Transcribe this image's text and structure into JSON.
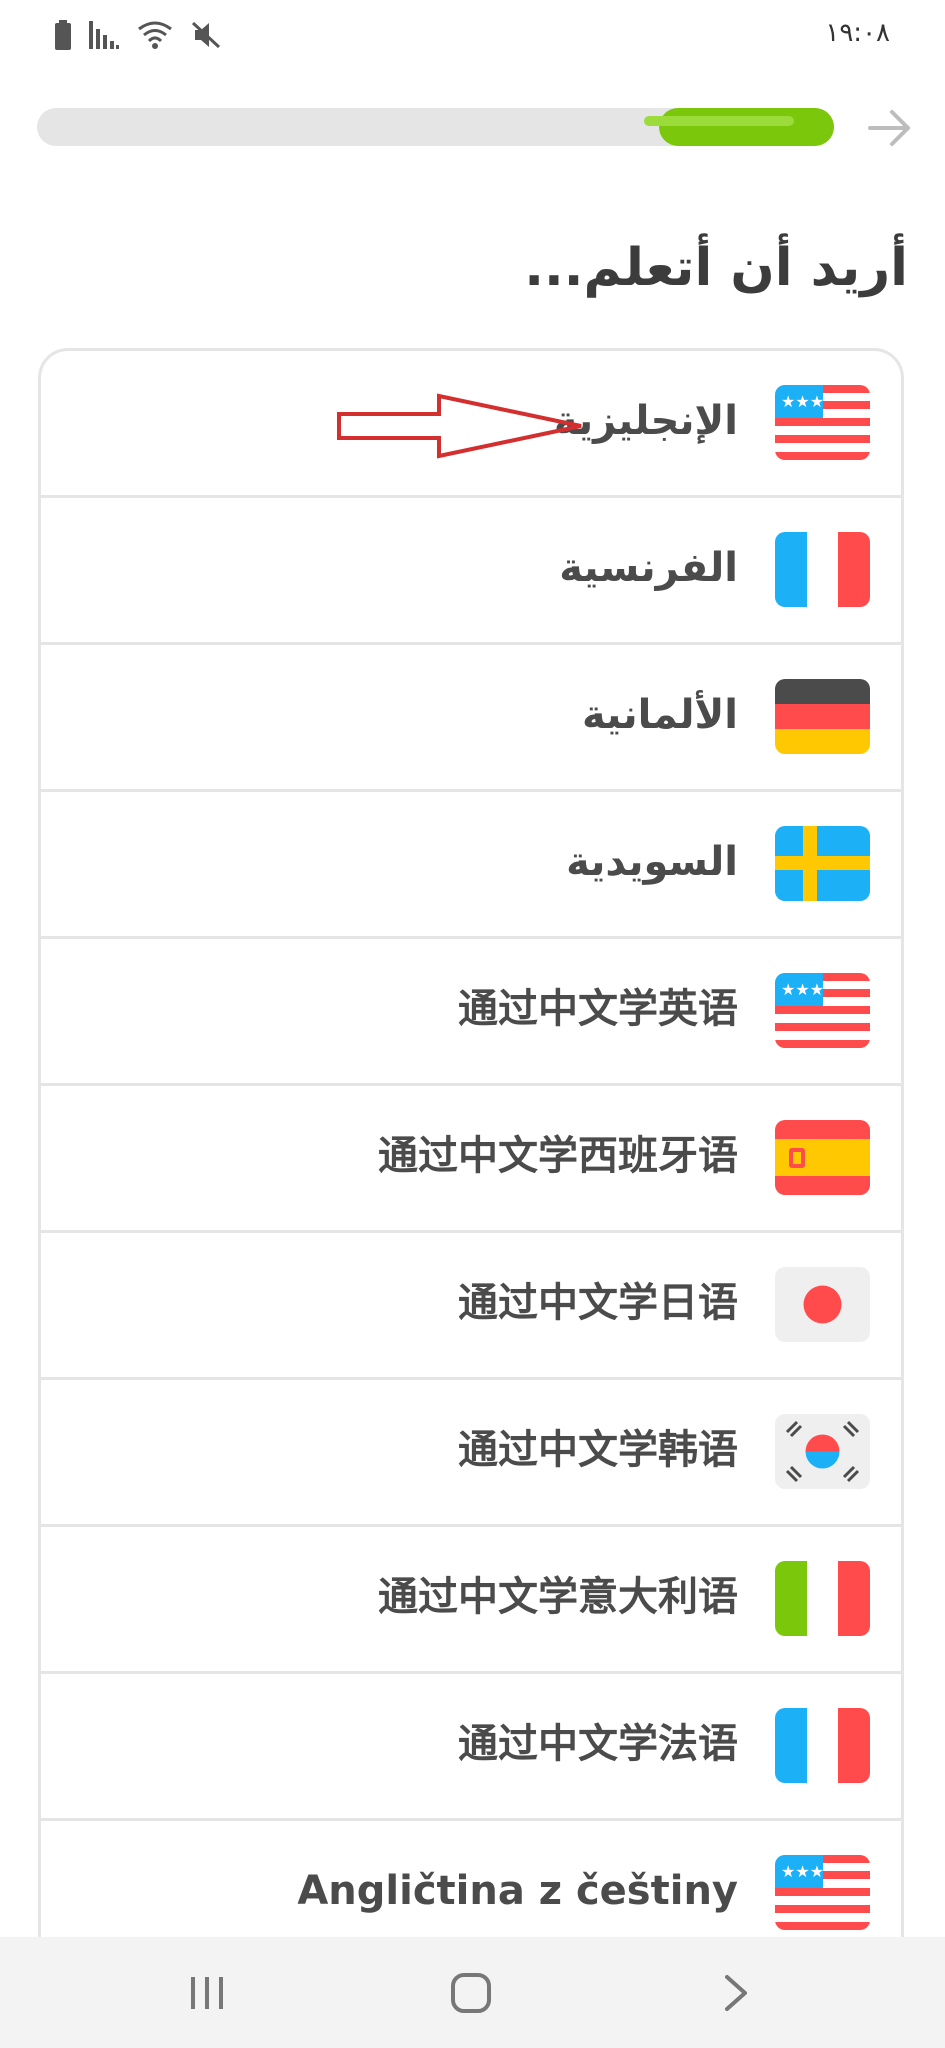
{
  "status_bar": {
    "time": "١٩:٠٨",
    "icons": [
      "battery-icon",
      "signal-icon",
      "wifi-icon",
      "mute-icon"
    ]
  },
  "progress": {
    "fraction": 0.22,
    "accent_color": "#7ac70c"
  },
  "header": {
    "next_icon": "arrow-right-icon"
  },
  "title": "أريد أن أتعلم...",
  "languages": [
    {
      "label": "الإنجليزية",
      "flag": "us-flag",
      "rtl": true
    },
    {
      "label": "الفرنسية",
      "flag": "france-flag",
      "rtl": true
    },
    {
      "label": "الألمانية",
      "flag": "germany-flag",
      "rtl": true
    },
    {
      "label": "السويدية",
      "flag": "sweden-flag",
      "rtl": true
    },
    {
      "label": "通过中文学英语",
      "flag": "us-flag",
      "rtl": false
    },
    {
      "label": "通过中文学西班牙语",
      "flag": "spain-flag",
      "rtl": false
    },
    {
      "label": "通过中文学日语",
      "flag": "japan-flag",
      "rtl": false
    },
    {
      "label": "通过中文学韩语",
      "flag": "korea-flag",
      "rtl": false
    },
    {
      "label": "通过中文学意大利语",
      "flag": "italy-flag",
      "rtl": false
    },
    {
      "label": "通过中文学法语",
      "flag": "france-flag",
      "rtl": false
    },
    {
      "label": "Angličtina z češtiny",
      "flag": "us-flag",
      "rtl": false
    }
  ],
  "annotation": {
    "icon": "red-outline-arrow-icon",
    "color": "#d32f2f"
  },
  "nav_bar": {
    "recents_icon": "recents-icon",
    "home_icon": "home-icon",
    "back_icon": "back-icon"
  }
}
